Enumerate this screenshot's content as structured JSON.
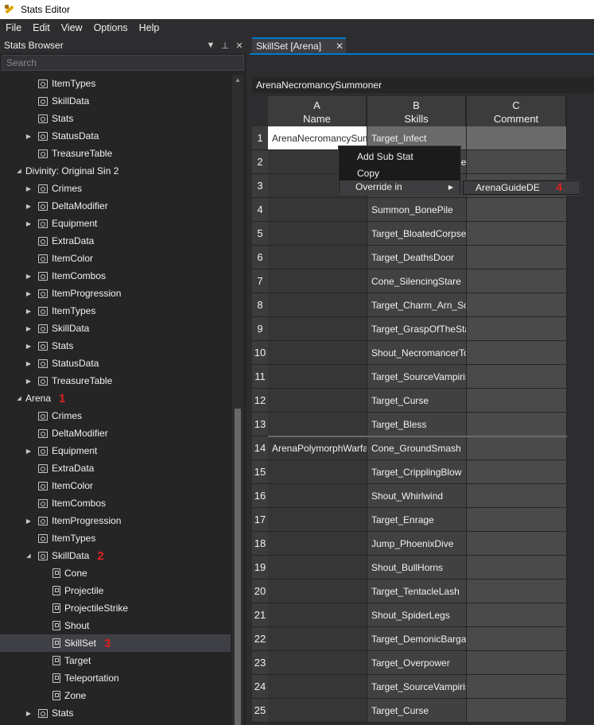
{
  "window": {
    "title": "Stats Editor"
  },
  "menu": [
    "File",
    "Edit",
    "View",
    "Options",
    "Help"
  ],
  "browser": {
    "title": "Stats Browser",
    "header_buttons": [
      "▼",
      "⊥",
      "✕"
    ],
    "search_placeholder": "Search",
    "tree": [
      {
        "label": "ItemTypes",
        "icon": "folder",
        "arrow": false,
        "level": 2
      },
      {
        "label": "SkillData",
        "icon": "folder",
        "arrow": false,
        "level": 2
      },
      {
        "label": "Stats",
        "icon": "folder",
        "arrow": false,
        "level": 2
      },
      {
        "label": "StatusData",
        "icon": "folder",
        "arrow": "right",
        "level": 2
      },
      {
        "label": "TreasureTable",
        "icon": "folder",
        "arrow": false,
        "level": 2
      },
      {
        "label": "Divinity: Original Sin 2",
        "icon": "none",
        "arrow": "down",
        "level": 1
      },
      {
        "label": "Crimes",
        "icon": "folder",
        "arrow": "right",
        "level": 2
      },
      {
        "label": "DeltaModifier",
        "icon": "folder",
        "arrow": "right",
        "level": 2
      },
      {
        "label": "Equipment",
        "icon": "folder",
        "arrow": "right",
        "level": 2
      },
      {
        "label": "ExtraData",
        "icon": "folder",
        "arrow": false,
        "level": 2
      },
      {
        "label": "ItemColor",
        "icon": "folder",
        "arrow": false,
        "level": 2
      },
      {
        "label": "ItemCombos",
        "icon": "folder",
        "arrow": "right",
        "level": 2
      },
      {
        "label": "ItemProgression",
        "icon": "folder",
        "arrow": "right",
        "level": 2
      },
      {
        "label": "ItemTypes",
        "icon": "folder",
        "arrow": "right",
        "level": 2
      },
      {
        "label": "SkillData",
        "icon": "folder",
        "arrow": "right",
        "level": 2
      },
      {
        "label": "Stats",
        "icon": "folder",
        "arrow": "right",
        "level": 2
      },
      {
        "label": "StatusData",
        "icon": "folder",
        "arrow": "right",
        "level": 2
      },
      {
        "label": "TreasureTable",
        "icon": "folder",
        "arrow": "right",
        "level": 2
      },
      {
        "label": "Arena",
        "icon": "none",
        "arrow": "down",
        "level": 1,
        "badge": "1"
      },
      {
        "label": "Crimes",
        "icon": "folder",
        "arrow": false,
        "level": 2
      },
      {
        "label": "DeltaModifier",
        "icon": "folder",
        "arrow": false,
        "level": 2
      },
      {
        "label": "Equipment",
        "icon": "folder",
        "arrow": "right",
        "level": 2
      },
      {
        "label": "ExtraData",
        "icon": "folder",
        "arrow": false,
        "level": 2
      },
      {
        "label": "ItemColor",
        "icon": "folder",
        "arrow": false,
        "level": 2
      },
      {
        "label": "ItemCombos",
        "icon": "folder",
        "arrow": false,
        "level": 2
      },
      {
        "label": "ItemProgression",
        "icon": "folder",
        "arrow": "right",
        "level": 2
      },
      {
        "label": "ItemTypes",
        "icon": "folder",
        "arrow": false,
        "level": 2
      },
      {
        "label": "SkillData",
        "icon": "folder",
        "arrow": "down",
        "level": 2,
        "badge": "2"
      },
      {
        "label": "Cone",
        "icon": "file",
        "arrow": false,
        "level": 3
      },
      {
        "label": "Projectile",
        "icon": "file",
        "arrow": false,
        "level": 3
      },
      {
        "label": "ProjectileStrike",
        "icon": "file",
        "arrow": false,
        "level": 3
      },
      {
        "label": "Shout",
        "icon": "file",
        "arrow": false,
        "level": 3
      },
      {
        "label": "SkillSet",
        "icon": "file",
        "arrow": false,
        "level": 3,
        "badge": "3",
        "selected": true
      },
      {
        "label": "Target",
        "icon": "file",
        "arrow": false,
        "level": 3
      },
      {
        "label": "Teleportation",
        "icon": "file",
        "arrow": false,
        "level": 3
      },
      {
        "label": "Zone",
        "icon": "file",
        "arrow": false,
        "level": 3
      },
      {
        "label": "Stats",
        "icon": "folder",
        "arrow": "right",
        "level": 2
      }
    ]
  },
  "editor": {
    "tab_label": "SkillSet [Arena]",
    "tab_close": "✕",
    "path": "ArenaNecromancySummoner",
    "columns": [
      {
        "letter": "A",
        "name": "Name"
      },
      {
        "letter": "B",
        "name": "Skills"
      },
      {
        "letter": "C",
        "name": "Comment"
      }
    ],
    "rows": [
      {
        "num": "1",
        "name": "ArenaNecromancySummoner",
        "skill": "Target_Infect"
      },
      {
        "num": "2",
        "name": "",
        "skill": "Target_DeathsDoorRessa"
      },
      {
        "num": "3",
        "name": "",
        "skill": ""
      },
      {
        "num": "4",
        "name": "",
        "skill": "Summon_BonePile"
      },
      {
        "num": "5",
        "name": "",
        "skill": "Target_BloatedCorpse"
      },
      {
        "num": "6",
        "name": "",
        "skill": "Target_DeathsDoor"
      },
      {
        "num": "7",
        "name": "",
        "skill": "Cone_SilencingStare"
      },
      {
        "num": "8",
        "name": "",
        "skill": "Target_Charm_Arn_Scroll"
      },
      {
        "num": "9",
        "name": "",
        "skill": "Target_GraspOfTheStarved"
      },
      {
        "num": "10",
        "name": "",
        "skill": "Shout_NecromancerTotem"
      },
      {
        "num": "11",
        "name": "",
        "skill": "Target_SourceVampirism"
      },
      {
        "num": "12",
        "name": "",
        "skill": "Target_Curse"
      },
      {
        "num": "13",
        "name": "",
        "skill": "Target_Bless"
      },
      {
        "num": "14",
        "name": "ArenaPolymorphWarfare",
        "skill": "Cone_GroundSmash"
      },
      {
        "num": "15",
        "name": "",
        "skill": "Target_CripplingBlow"
      },
      {
        "num": "16",
        "name": "",
        "skill": "Shout_Whirlwind"
      },
      {
        "num": "17",
        "name": "",
        "skill": "Target_Enrage"
      },
      {
        "num": "18",
        "name": "",
        "skill": "Jump_PhoenixDive"
      },
      {
        "num": "19",
        "name": "",
        "skill": "Shout_BullHorns"
      },
      {
        "num": "20",
        "name": "",
        "skill": "Target_TentacleLash"
      },
      {
        "num": "21",
        "name": "",
        "skill": "Shout_SpiderLegs"
      },
      {
        "num": "22",
        "name": "",
        "skill": "Target_DemonicBargain"
      },
      {
        "num": "23",
        "name": "",
        "skill": "Target_Overpower"
      },
      {
        "num": "24",
        "name": "",
        "skill": "Target_SourceVampirism"
      },
      {
        "num": "25",
        "name": "",
        "skill": "Target_Curse"
      }
    ]
  },
  "context_menu": {
    "items": [
      "Add Sub Stat",
      "Copy",
      "Override in"
    ],
    "submenu_item": "ArenaGuideDE",
    "submenu_badge": "4"
  }
}
